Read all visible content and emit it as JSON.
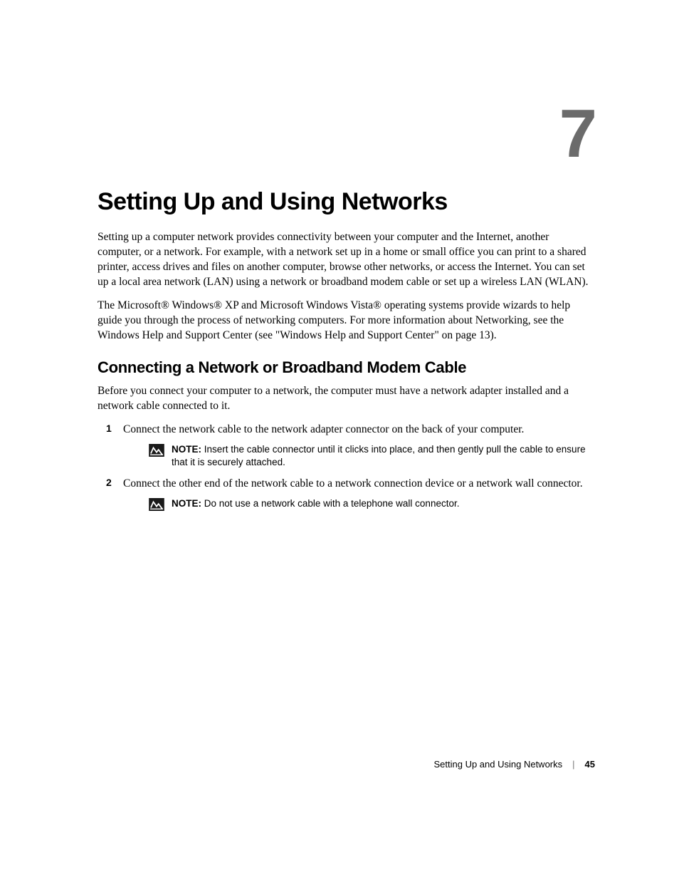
{
  "chapter_number": "7",
  "title": "Setting Up and Using Networks",
  "intro_p1": "Setting up a computer network provides connectivity between your computer and the Internet, another computer, or a network. For example, with a network set up in a home or small office you can print to a shared printer, access drives and files on another computer, browse other networks, or access the Internet. You can set up a local area network (LAN) using a network or broadband modem cable or set up a wireless LAN (WLAN).",
  "intro_p2": "The Microsoft® Windows® XP and Microsoft Windows Vista® operating systems provide wizards to help guide you through the process of networking computers. For more information about Networking, see the Windows Help and Support Center (see \"Windows Help and Support Center\" on page 13).",
  "section1": {
    "heading": "Connecting a Network or Broadband Modem Cable",
    "intro": "Before you connect your computer to a network, the computer must have a network adapter installed and a network cable connected to it.",
    "steps": [
      {
        "num": "1",
        "text": "Connect the network cable to the network adapter connector on the back of your computer.",
        "note_label": "NOTE:",
        "note": " Insert the cable connector until it clicks into place, and then gently pull the cable to ensure that it is securely attached."
      },
      {
        "num": "2",
        "text": "Connect the other end of the network cable to a network connection device or a network wall connector.",
        "note_label": "NOTE:",
        "note": " Do not use a network cable with a telephone wall connector."
      }
    ]
  },
  "footer": {
    "title": "Setting Up and Using Networks",
    "separator": "|",
    "page": "45"
  }
}
